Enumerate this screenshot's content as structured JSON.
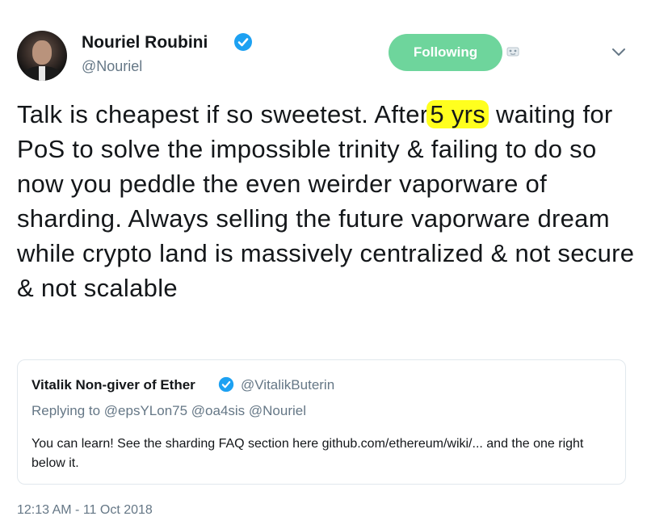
{
  "author": {
    "name": "Nouriel Roubini",
    "handle": "@Nouriel"
  },
  "follow_button": {
    "label": "Following",
    "color": "#6ed59c"
  },
  "icons": {
    "verified": "verified-badge-icon",
    "notifications": "notification-bell-icon",
    "menu": "chevron-down-icon"
  },
  "tweet": {
    "text_before": "Talk is cheapest if so sweetest. After",
    "highlight": "5 yrs",
    "text_after": " waiting for PoS to solve the impossible trinity & failing to do so now you peddle the even weirder vaporware of sharding. Always selling the future vaporware dream while crypto land is massively centralized & not secure & not scalable",
    "highlight_color": "#ffff1e"
  },
  "quoted_tweet": {
    "name": "Vitalik Non-giver of Ether",
    "handle": "@VitalikButerin",
    "reply_to": "Replying to @epsYLon75 @oa4sis @Nouriel",
    "text": "You can learn! See the sharding FAQ section here github.com/ethereum/wiki/... and the one right below it."
  },
  "timestamp": "12:13 AM - 11 Oct 2018"
}
